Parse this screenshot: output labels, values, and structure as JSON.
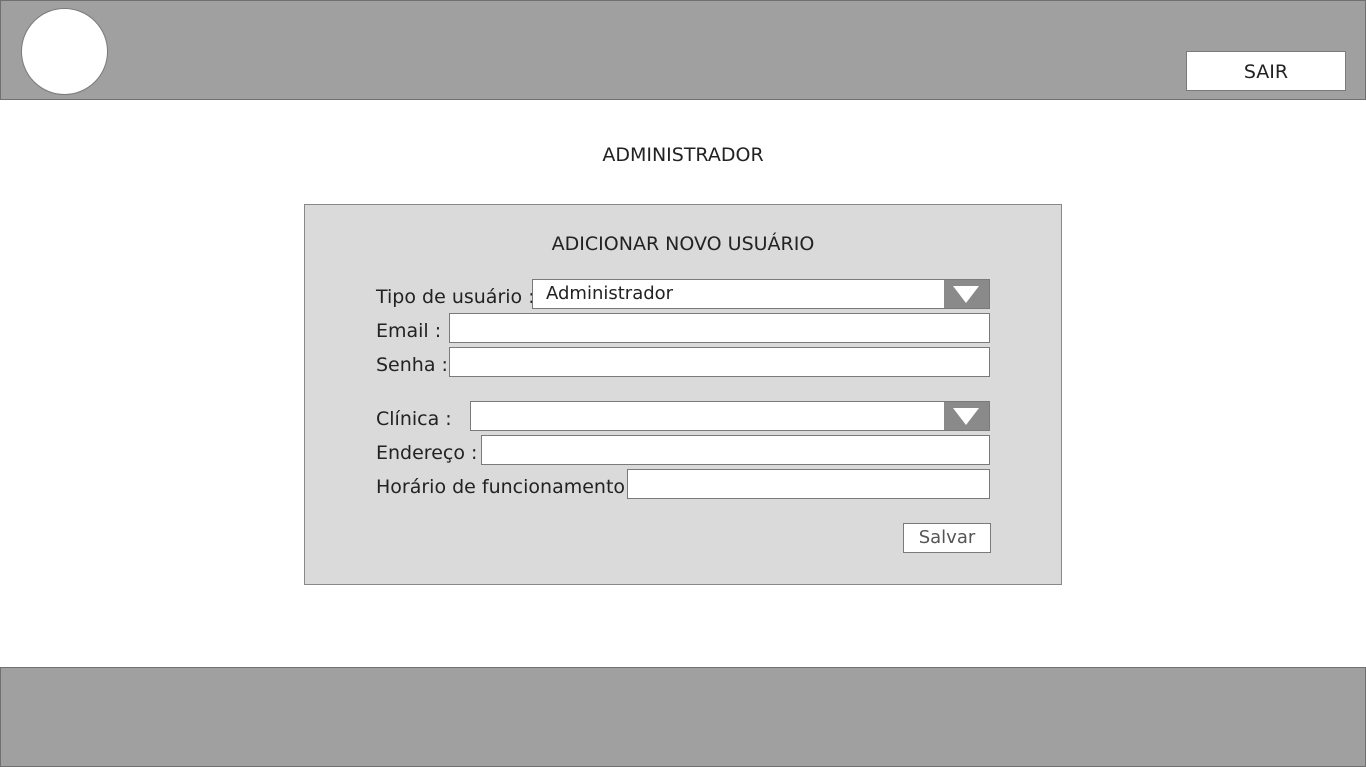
{
  "header": {
    "logout_label": "SAIR"
  },
  "page": {
    "title": "ADMINISTRADOR"
  },
  "form": {
    "title": "ADICIONAR NOVO USUÁRIO",
    "user_type": {
      "label": "Tipo de usuário :",
      "value": "Administrador"
    },
    "email": {
      "label": "Email :",
      "value": ""
    },
    "password": {
      "label": "Senha :",
      "value": ""
    },
    "clinic": {
      "label": "Clínica :",
      "value": ""
    },
    "address": {
      "label": "Endereço :",
      "value": ""
    },
    "hours": {
      "label": "Horário de funcionamento :",
      "value": ""
    },
    "save_label": "Salvar"
  },
  "icons": {
    "logo": "logo-circle",
    "dropdown": "chevron-down-icon"
  },
  "colors": {
    "bar": "#a0a0a0",
    "panel": "#dadada",
    "dropdown_button": "#8a8a8a"
  }
}
